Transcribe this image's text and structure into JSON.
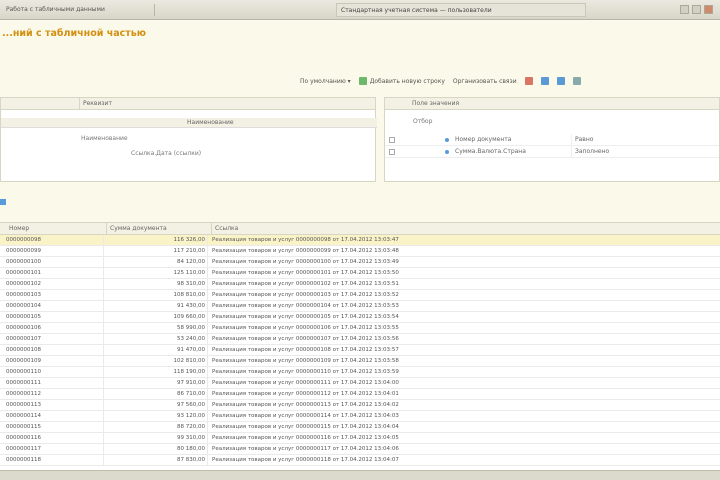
{
  "titlebar": {
    "left_tab": "Работа с табличными данными",
    "center_tab": "Стандартная учетная система — пользователи",
    "controls": [
      "minimize-icon",
      "maximize-icon",
      "close-icon"
    ]
  },
  "page": {
    "title": "...ний с табличной частью"
  },
  "toolbar": {
    "items": [
      {
        "label": "По умолчанию ▾",
        "icon": ""
      },
      {
        "label": "Добавить новую строку",
        "icon": "add-icon"
      },
      {
        "label": "Организовать связи",
        "icon": ""
      }
    ],
    "icon_buttons": [
      "delete-icon",
      "move-up-icon",
      "move-down-icon",
      "settings-icon"
    ]
  },
  "left_panel": {
    "header": [
      "",
      "Реквизит"
    ],
    "subheader": "Наименование",
    "items": [
      "Наименование",
      "Ссылка.Дата (ссылки)"
    ]
  },
  "right_panel": {
    "header": "Поле значения",
    "tree_root": "Отбор",
    "rows": [
      {
        "key": "Номер документа",
        "value": "Равно"
      },
      {
        "key": "Сумма.Валюта.Страна",
        "value": "Заполнено"
      }
    ]
  },
  "table": {
    "columns": [
      "Номер",
      "Сумма документа",
      "Ссылка"
    ],
    "rows": [
      {
        "num": "0000000098",
        "sum": "116 326,00",
        "ref": "Реализация товаров и услуг 0000000098 от 17.04.2012 13:03:47"
      },
      {
        "num": "0000000099",
        "sum": "117 210,00",
        "ref": "Реализация товаров и услуг 0000000099 от 17.04.2012 13:03:48"
      },
      {
        "num": "0000000100",
        "sum": "84 120,00",
        "ref": "Реализация товаров и услуг 0000000100 от 17.04.2012 13:03:49"
      },
      {
        "num": "0000000101",
        "sum": "125 110,00",
        "ref": "Реализация товаров и услуг 0000000101 от 17.04.2012 13:03:50"
      },
      {
        "num": "0000000102",
        "sum": "98 310,00",
        "ref": "Реализация товаров и услуг 0000000102 от 17.04.2012 13:03:51"
      },
      {
        "num": "0000000103",
        "sum": "108 810,00",
        "ref": "Реализация товаров и услуг 0000000103 от 17.04.2012 13:03:52"
      },
      {
        "num": "0000000104",
        "sum": "91 430,00",
        "ref": "Реализация товаров и услуг 0000000104 от 17.04.2012 13:03:53"
      },
      {
        "num": "0000000105",
        "sum": "109 660,00",
        "ref": "Реализация товаров и услуг 0000000105 от 17.04.2012 13:03:54"
      },
      {
        "num": "0000000106",
        "sum": "58 990,00",
        "ref": "Реализация товаров и услуг 0000000106 от 17.04.2012 13:03:55"
      },
      {
        "num": "0000000107",
        "sum": "53 240,00",
        "ref": "Реализация товаров и услуг 0000000107 от 17.04.2012 13:03:56"
      },
      {
        "num": "0000000108",
        "sum": "91 470,00",
        "ref": "Реализация товаров и услуг 0000000108 от 17.04.2012 13:03:57"
      },
      {
        "num": "0000000109",
        "sum": "102 810,00",
        "ref": "Реализация товаров и услуг 0000000109 от 17.04.2012 13:03:58"
      },
      {
        "num": "0000000110",
        "sum": "118 190,00",
        "ref": "Реализация товаров и услуг 0000000110 от 17.04.2012 13:03:59"
      },
      {
        "num": "0000000111",
        "sum": "97 910,00",
        "ref": "Реализация товаров и услуг 0000000111 от 17.04.2012 13:04:00"
      },
      {
        "num": "0000000112",
        "sum": "86 710,00",
        "ref": "Реализация товаров и услуг 0000000112 от 17.04.2012 13:04:01"
      },
      {
        "num": "0000000113",
        "sum": "97 560,00",
        "ref": "Реализация товаров и услуг 0000000113 от 17.04.2012 13:04:02"
      },
      {
        "num": "0000000114",
        "sum": "93 120,00",
        "ref": "Реализация товаров и услуг 0000000114 от 17.04.2012 13:04:03"
      },
      {
        "num": "0000000115",
        "sum": "88 720,00",
        "ref": "Реализация товаров и услуг 0000000115 от 17.04.2012 13:04:04"
      },
      {
        "num": "0000000116",
        "sum": "99 310,00",
        "ref": "Реализация товаров и услуг 0000000116 от 17.04.2012 13:04:05"
      },
      {
        "num": "0000000117",
        "sum": "80 180,00",
        "ref": "Реализация товаров и услуг 0000000117 от 17.04.2012 13:04:06"
      },
      {
        "num": "0000000118",
        "sum": "87 830,00",
        "ref": "Реализация товаров и услуг 0000000118 от 17.04.2012 13:04:07"
      }
    ]
  }
}
